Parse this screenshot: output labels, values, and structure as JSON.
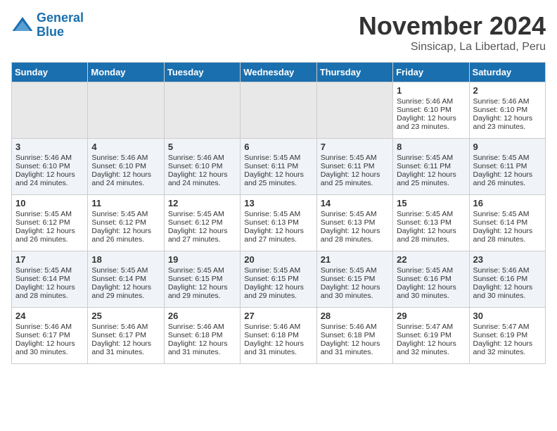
{
  "logo": {
    "line1": "General",
    "line2": "Blue"
  },
  "title": "November 2024",
  "location": "Sinsicap, La Libertad, Peru",
  "days_of_week": [
    "Sunday",
    "Monday",
    "Tuesday",
    "Wednesday",
    "Thursday",
    "Friday",
    "Saturday"
  ],
  "weeks": [
    [
      {
        "day": "",
        "info": ""
      },
      {
        "day": "",
        "info": ""
      },
      {
        "day": "",
        "info": ""
      },
      {
        "day": "",
        "info": ""
      },
      {
        "day": "",
        "info": ""
      },
      {
        "day": "1",
        "info": "Sunrise: 5:46 AM\nSunset: 6:10 PM\nDaylight: 12 hours and 23 minutes."
      },
      {
        "day": "2",
        "info": "Sunrise: 5:46 AM\nSunset: 6:10 PM\nDaylight: 12 hours and 23 minutes."
      }
    ],
    [
      {
        "day": "3",
        "info": "Sunrise: 5:46 AM\nSunset: 6:10 PM\nDaylight: 12 hours and 24 minutes."
      },
      {
        "day": "4",
        "info": "Sunrise: 5:46 AM\nSunset: 6:10 PM\nDaylight: 12 hours and 24 minutes."
      },
      {
        "day": "5",
        "info": "Sunrise: 5:46 AM\nSunset: 6:10 PM\nDaylight: 12 hours and 24 minutes."
      },
      {
        "day": "6",
        "info": "Sunrise: 5:45 AM\nSunset: 6:11 PM\nDaylight: 12 hours and 25 minutes."
      },
      {
        "day": "7",
        "info": "Sunrise: 5:45 AM\nSunset: 6:11 PM\nDaylight: 12 hours and 25 minutes."
      },
      {
        "day": "8",
        "info": "Sunrise: 5:45 AM\nSunset: 6:11 PM\nDaylight: 12 hours and 25 minutes."
      },
      {
        "day": "9",
        "info": "Sunrise: 5:45 AM\nSunset: 6:11 PM\nDaylight: 12 hours and 26 minutes."
      }
    ],
    [
      {
        "day": "10",
        "info": "Sunrise: 5:45 AM\nSunset: 6:12 PM\nDaylight: 12 hours and 26 minutes."
      },
      {
        "day": "11",
        "info": "Sunrise: 5:45 AM\nSunset: 6:12 PM\nDaylight: 12 hours and 26 minutes."
      },
      {
        "day": "12",
        "info": "Sunrise: 5:45 AM\nSunset: 6:12 PM\nDaylight: 12 hours and 27 minutes."
      },
      {
        "day": "13",
        "info": "Sunrise: 5:45 AM\nSunset: 6:13 PM\nDaylight: 12 hours and 27 minutes."
      },
      {
        "day": "14",
        "info": "Sunrise: 5:45 AM\nSunset: 6:13 PM\nDaylight: 12 hours and 28 minutes."
      },
      {
        "day": "15",
        "info": "Sunrise: 5:45 AM\nSunset: 6:13 PM\nDaylight: 12 hours and 28 minutes."
      },
      {
        "day": "16",
        "info": "Sunrise: 5:45 AM\nSunset: 6:14 PM\nDaylight: 12 hours and 28 minutes."
      }
    ],
    [
      {
        "day": "17",
        "info": "Sunrise: 5:45 AM\nSunset: 6:14 PM\nDaylight: 12 hours and 28 minutes."
      },
      {
        "day": "18",
        "info": "Sunrise: 5:45 AM\nSunset: 6:14 PM\nDaylight: 12 hours and 29 minutes."
      },
      {
        "day": "19",
        "info": "Sunrise: 5:45 AM\nSunset: 6:15 PM\nDaylight: 12 hours and 29 minutes."
      },
      {
        "day": "20",
        "info": "Sunrise: 5:45 AM\nSunset: 6:15 PM\nDaylight: 12 hours and 29 minutes."
      },
      {
        "day": "21",
        "info": "Sunrise: 5:45 AM\nSunset: 6:15 PM\nDaylight: 12 hours and 30 minutes."
      },
      {
        "day": "22",
        "info": "Sunrise: 5:45 AM\nSunset: 6:16 PM\nDaylight: 12 hours and 30 minutes."
      },
      {
        "day": "23",
        "info": "Sunrise: 5:46 AM\nSunset: 6:16 PM\nDaylight: 12 hours and 30 minutes."
      }
    ],
    [
      {
        "day": "24",
        "info": "Sunrise: 5:46 AM\nSunset: 6:17 PM\nDaylight: 12 hours and 30 minutes."
      },
      {
        "day": "25",
        "info": "Sunrise: 5:46 AM\nSunset: 6:17 PM\nDaylight: 12 hours and 31 minutes."
      },
      {
        "day": "26",
        "info": "Sunrise: 5:46 AM\nSunset: 6:18 PM\nDaylight: 12 hours and 31 minutes."
      },
      {
        "day": "27",
        "info": "Sunrise: 5:46 AM\nSunset: 6:18 PM\nDaylight: 12 hours and 31 minutes."
      },
      {
        "day": "28",
        "info": "Sunrise: 5:46 AM\nSunset: 6:18 PM\nDaylight: 12 hours and 31 minutes."
      },
      {
        "day": "29",
        "info": "Sunrise: 5:47 AM\nSunset: 6:19 PM\nDaylight: 12 hours and 32 minutes."
      },
      {
        "day": "30",
        "info": "Sunrise: 5:47 AM\nSunset: 6:19 PM\nDaylight: 12 hours and 32 minutes."
      }
    ]
  ]
}
